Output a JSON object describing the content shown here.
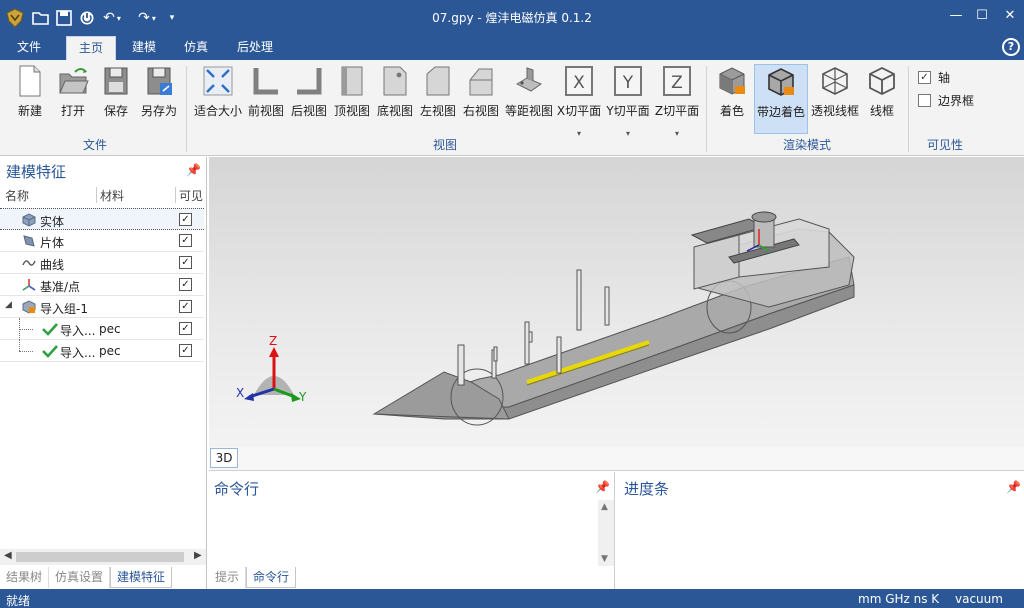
{
  "window": {
    "title": "07.gpy -  煌沣电磁仿真 0.1.2",
    "controls": [
      "—",
      "☐",
      "✕"
    ]
  },
  "menu": {
    "items": [
      "文件",
      "主页",
      "建模",
      "仿真",
      "后处理"
    ],
    "active": "主页",
    "help": "?"
  },
  "ribbon": {
    "groups": {
      "file": "文件",
      "view": "视图",
      "render": "渲染模式",
      "visibility": "可见性"
    },
    "file_buttons": [
      "新建",
      "打开",
      "保存",
      "另存为"
    ],
    "view_buttons": [
      "适合大小",
      "前视图",
      "后视图",
      "顶视图",
      "底视图",
      "左视图",
      "右视图",
      "等距视图",
      "X切平面",
      "Y切平面",
      "Z切平面"
    ],
    "render_buttons": [
      "着色",
      "带边着色",
      "透视线框",
      "线框"
    ],
    "render_selected": "带边着色",
    "visibility": [
      {
        "label": "轴",
        "checked": true
      },
      {
        "label": "边界框",
        "checked": false
      }
    ]
  },
  "left_panel": {
    "title": "建模特征",
    "columns": [
      "名称",
      "材料",
      "可见"
    ],
    "rows": [
      {
        "name": "实体",
        "material": "",
        "visible": true
      },
      {
        "name": "片体",
        "material": "",
        "visible": true
      },
      {
        "name": "曲线",
        "material": "",
        "visible": true
      },
      {
        "name": "基准/点",
        "material": "",
        "visible": true
      },
      {
        "name": "导入组-1",
        "material": "",
        "visible": true
      },
      {
        "name": "导入...",
        "material": "pec",
        "visible": true
      },
      {
        "name": "导入...",
        "material": "pec",
        "visible": true
      }
    ],
    "tabs": [
      "结果树",
      "仿真设置",
      "建模特征"
    ],
    "active_tab": "建模特征"
  },
  "viewport": {
    "tab": "3D",
    "axes": {
      "x": "X",
      "y": "Y",
      "z": "Z"
    }
  },
  "command_panel": {
    "title": "命令行",
    "tabs": [
      "提示",
      "命令行"
    ],
    "active_tab": "命令行"
  },
  "progress_panel": {
    "title": "进度条"
  },
  "status": {
    "left": "就绪",
    "units": "mm GHz ns K",
    "medium": "vacuum"
  }
}
